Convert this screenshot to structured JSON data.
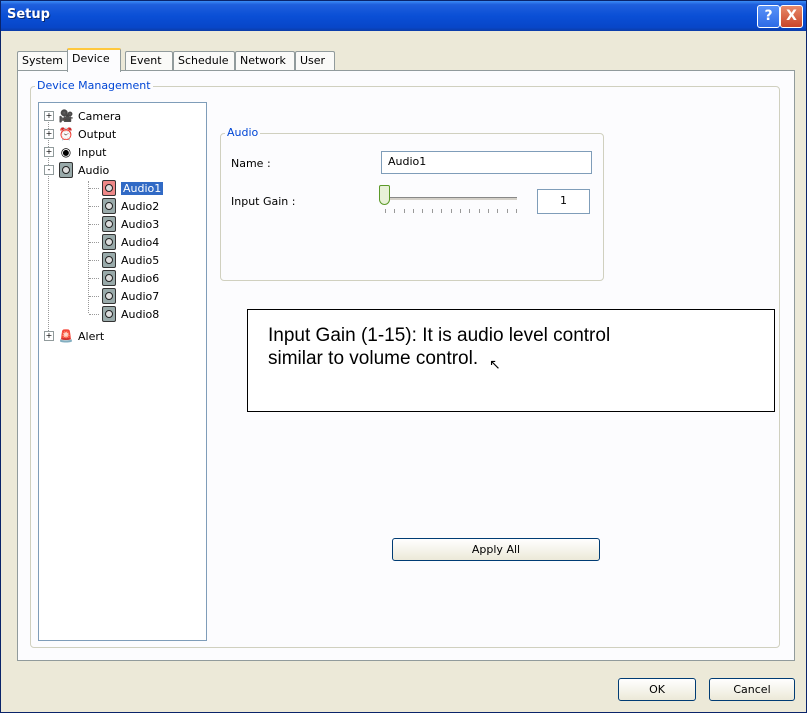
{
  "window": {
    "title": "Setup",
    "help_button": "?",
    "close_button": "X"
  },
  "tabs": [
    "System",
    "Device",
    "Event",
    "Schedule",
    "Network",
    "User"
  ],
  "active_tab": "Device",
  "device_management": {
    "legend": "Device Management"
  },
  "tree": {
    "top": [
      {
        "label": "Camera",
        "icon": "camera-icon",
        "expander": "+"
      },
      {
        "label": "Output",
        "icon": "output-icon",
        "expander": "+"
      },
      {
        "label": "Input",
        "icon": "input-icon",
        "expander": "+"
      },
      {
        "label": "Audio",
        "icon": "audio-icon",
        "expander": "-"
      }
    ],
    "audio_children": [
      "Audio1",
      "Audio2",
      "Audio3",
      "Audio4",
      "Audio5",
      "Audio6",
      "Audio7",
      "Audio8"
    ],
    "selected": "Audio1",
    "alert": {
      "label": "Alert",
      "icon": "alert-icon",
      "expander": "+"
    }
  },
  "audio_group": {
    "legend": "Audio",
    "name_label": "Name :",
    "name_value": "Audio1",
    "gain_label": "Input Gain :",
    "gain_value": "1",
    "gain_min": 1,
    "gain_max": 15
  },
  "note": {
    "line1": "Input Gain (1-15): It is audio level control",
    "line2": "similar to volume control."
  },
  "buttons": {
    "apply_all": "Apply All",
    "ok": "OK",
    "cancel": "Cancel"
  }
}
